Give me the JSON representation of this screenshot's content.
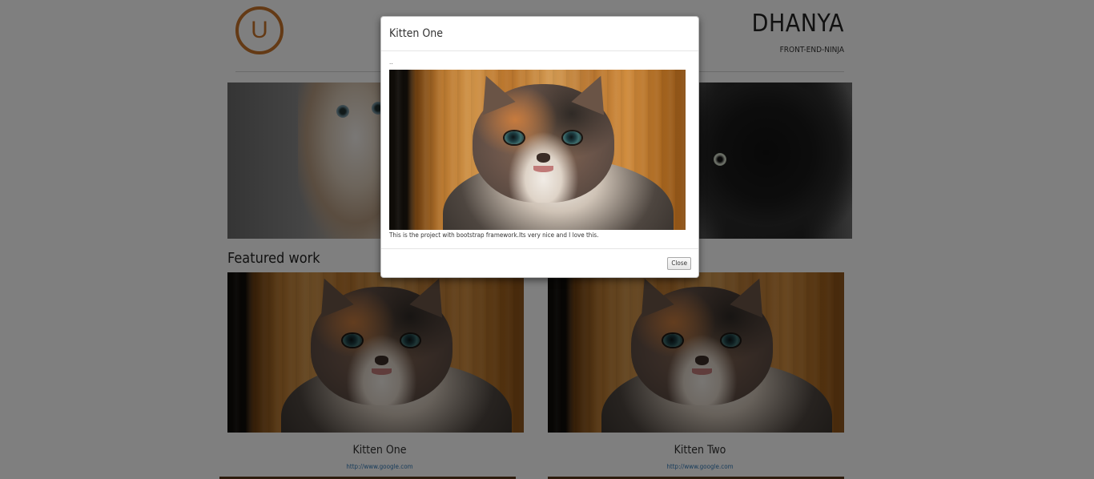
{
  "header": {
    "logo_letter": "U",
    "brand_name": "DHANYA",
    "tagline": "FRONT-END-NINJA"
  },
  "featured": {
    "section_title": "Featured work",
    "cards": [
      {
        "title": "Kitten One",
        "link": "http://www.google.com"
      },
      {
        "title": "Kitten Two",
        "link": "http://www.google.com"
      }
    ]
  },
  "modal": {
    "title": "Kitten One",
    "tiny_text": "..",
    "description": "This is the project with bootstrap framework.Its very nice and I love this.",
    "close_label": "Close"
  },
  "colors": {
    "logo_accent": "#c8742a",
    "link": "#337ab7",
    "backdrop": "rgba(0,0,0,0.5)"
  }
}
